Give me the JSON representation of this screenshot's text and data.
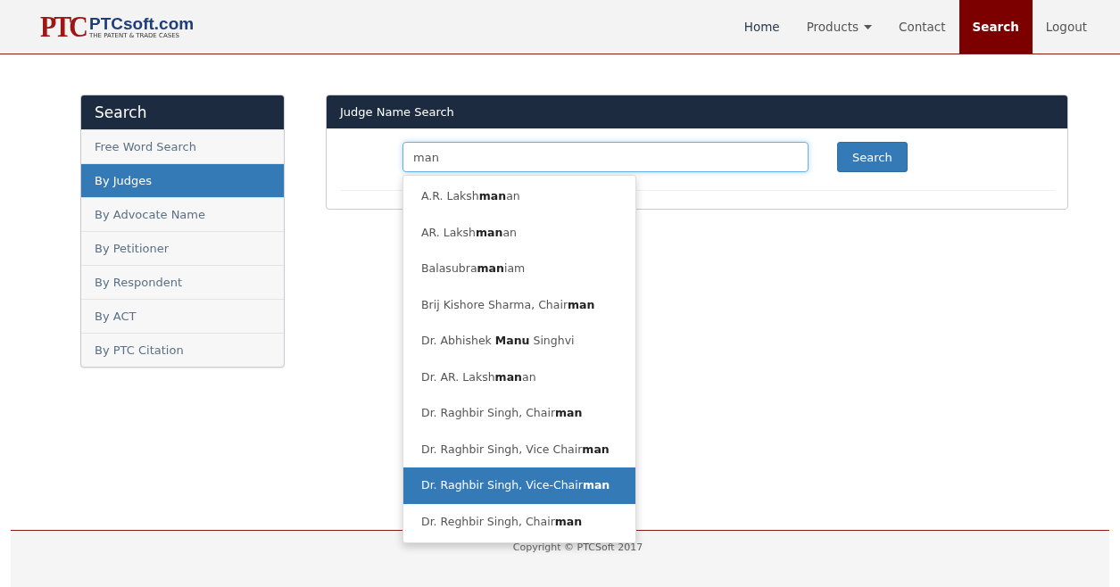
{
  "logo": {
    "mark": "PTC",
    "name": "PTCsoft.com",
    "tagline": "THE PATENT & TRADE CASES"
  },
  "nav": [
    {
      "label": "Home",
      "selected": false,
      "dropdown": false
    },
    {
      "label": "Products",
      "selected": false,
      "dropdown": true
    },
    {
      "label": "Contact",
      "selected": false,
      "dropdown": false
    },
    {
      "label": "Search",
      "selected": true,
      "dropdown": false
    },
    {
      "label": "Logout",
      "selected": false,
      "dropdown": false
    }
  ],
  "sidebar": {
    "title": "Search",
    "items": [
      {
        "label": "Free Word Search",
        "selected": false
      },
      {
        "label": "By Judges",
        "selected": true
      },
      {
        "label": "By Advocate Name",
        "selected": false
      },
      {
        "label": "By Petitioner",
        "selected": false
      },
      {
        "label": "By Respondent",
        "selected": false
      },
      {
        "label": "By ACT",
        "selected": false
      },
      {
        "label": "By PTC Citation",
        "selected": false
      }
    ]
  },
  "panel": {
    "title": "Judge Name Search",
    "search_field": {
      "value": "man"
    },
    "search_button": "Search"
  },
  "suggestions": [
    {
      "label": "A.R. Laksh**man**an",
      "selected": false
    },
    {
      "label": "AR. Laksh**man**an",
      "selected": false
    },
    {
      "label": "Balasubra**man**iam",
      "selected": false
    },
    {
      "label": "Brij Kishore Sharma, Chair**man**",
      "selected": false
    },
    {
      "label": "Dr. Abhishek **Manu** Singhvi",
      "selected": false
    },
    {
      "label": "Dr. AR. Laksh**man**an",
      "selected": false
    },
    {
      "label": "Dr. Raghbir Singh, Chair**man**",
      "selected": false
    },
    {
      "label": "Dr. Raghbir Singh, Vice Chair**man**",
      "selected": false
    },
    {
      "label": "Dr. Raghbir Singh, Vice-Chair**man**",
      "selected": true
    },
    {
      "label": "Dr. Reghbir Singh, Chair**man**",
      "selected": false
    }
  ],
  "footer": {
    "copyright": "Copyright © PTCSoft 2017"
  }
}
